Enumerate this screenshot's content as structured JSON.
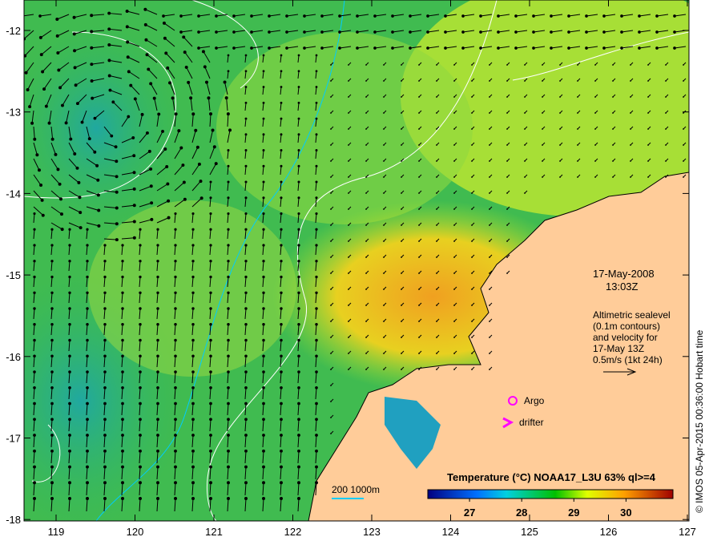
{
  "map": {
    "x_ticks": [
      "119",
      "120",
      "121",
      "122",
      "123",
      "124",
      "125",
      "126",
      "127"
    ],
    "y_ticks": [
      "-12",
      "-13",
      "-14",
      "-15",
      "-16",
      "-17",
      "-18"
    ],
    "date": "17-May-2008",
    "time": "13:03Z",
    "altimetry_lines": [
      "Altimetric sealevel",
      "(0.1m contours)",
      "and velocity for",
      "17-May 13Z",
      "0.5m/s (1kt 24h)"
    ],
    "argo_label": "Argo",
    "drifter_label": "drifter",
    "depth_label": "200  1000m",
    "credit": "© IMOS 05-Apr-2015 00:36:00 Hobart time"
  },
  "legend": {
    "title": "Temperature (°C) NOAA17_L3U 63% ql>=4",
    "ticks": [
      "27",
      "28",
      "29",
      "30"
    ],
    "range": [
      26.2,
      30.9
    ]
  },
  "colors": {
    "land": "#FFCC99",
    "ocean": "#33BB55",
    "warm": "#F0A020",
    "argo": "#FF00FF",
    "isobath": "#00CCFF"
  }
}
